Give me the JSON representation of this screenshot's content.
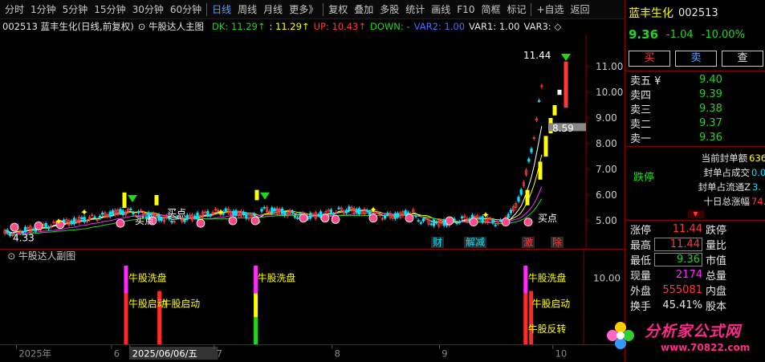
{
  "toolbar": {
    "items": [
      "分时",
      "1分钟",
      "5分钟",
      "15分钟",
      "30分钟",
      "60分钟",
      "日线",
      "周线",
      "月线",
      "更多》",
      "复权",
      "叠加",
      "多股",
      "统计",
      "画线",
      "F10",
      "简框",
      "标记",
      "+自选",
      "返回"
    ],
    "active": "日线"
  },
  "stock": {
    "code": "002513",
    "name": "蓝丰生化",
    "price": "9.36",
    "change": "-1.04",
    "change_pct": "-10.00%"
  },
  "legend": {
    "prefix": "002513 蓝丰生化(日线,前复权)",
    "indicator": "牛股达人主图",
    "dk": "DK: 11.29↑",
    "val2": ": 11.29↑",
    "up": "UP: 10.43↑",
    "down": "DOWN: -",
    "var2": "VAR2: 1.00",
    "var1": "VAR1: 1.00",
    "var3": "VAR3: ◇"
  },
  "main_chart": {
    "y_ticks": [
      "11.00",
      "10.00",
      "9.00",
      "8.00",
      "7.00",
      "6.00",
      "5.00"
    ],
    "high_label": "11.44",
    "low_label": "4.33",
    "price_tag": "8.59",
    "buy_labels": [
      "买点",
      "买点",
      "买点"
    ],
    "event_tags": [
      "财",
      "解减",
      "激",
      "除"
    ]
  },
  "sub_chart": {
    "title": "牛股达人副图",
    "y_tick": "10.00",
    "labels": [
      "牛股洗盘",
      "牛股启动",
      "牛股启动",
      "牛股洗盘",
      "牛股洗盘",
      "牛股启动",
      "牛股反转"
    ]
  },
  "x_axis": {
    "labels": [
      "2025年",
      "6",
      "2025/06/06/五",
      "7",
      "8",
      "9",
      "10"
    ]
  },
  "order_book": {
    "buttons": [
      "买",
      "卖",
      "查"
    ],
    "asks": [
      {
        "label": "卖五 ¥",
        "price": "9.40"
      },
      {
        "label": "卖四",
        "price": "9.39"
      },
      {
        "label": "卖三",
        "price": "9.38"
      },
      {
        "label": "卖二",
        "price": "9.37"
      },
      {
        "label": "卖一",
        "price": "9.36"
      }
    ],
    "status": "跌停",
    "info": [
      {
        "label": "当前封单额",
        "value": "636"
      },
      {
        "label": "封单占成交",
        "value": "0.0"
      },
      {
        "label": "封单占流通Z",
        "value": "3."
      },
      {
        "label": "十日总涨幅",
        "value": "74."
      }
    ]
  },
  "quote": {
    "rows": [
      {
        "l1": "涨停",
        "v1": "11.44",
        "l2": "跌停"
      },
      {
        "l1": "最高",
        "v1": "11.44",
        "l2": "量比"
      },
      {
        "l1": "最低",
        "v1": "9.36",
        "l2": "市值"
      },
      {
        "l1": "现量",
        "v1": "2174",
        "l2": "总量"
      },
      {
        "l1": "外盘",
        "v1": "555081",
        "l2": "内盘"
      },
      {
        "l1": "换手",
        "v1": "45.41%",
        "l2": "股本"
      }
    ]
  },
  "watermark": {
    "title": "分析家公式网",
    "url": "www.70822.com"
  },
  "colors": {
    "up": "#ff3a3a",
    "down": "#1ed81e",
    "accent": "#ffff00",
    "border": "#8b0000"
  }
}
